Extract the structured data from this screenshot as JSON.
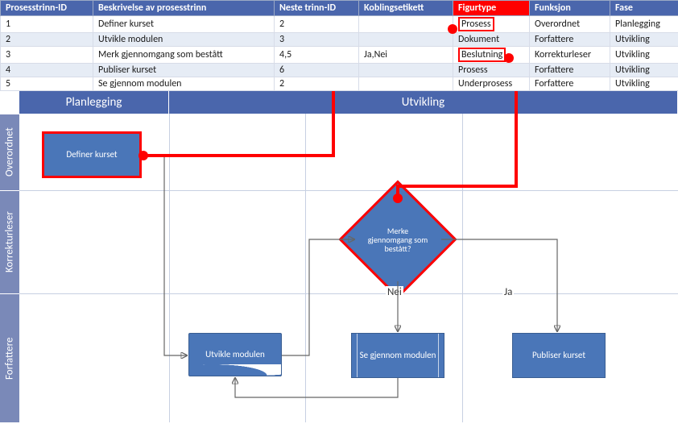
{
  "table": {
    "headers": {
      "id": "Prosesstrinn-ID",
      "desc": "Beskrivelse av prosesstrinn",
      "next": "Neste trinn-ID",
      "conn": "Koblingsetikett",
      "shape": "Figurtype",
      "func": "Funksjon",
      "phase": "Fase"
    },
    "rows": [
      {
        "id": "1",
        "desc": "Definer kurset",
        "next": "2",
        "conn": "",
        "shape": "Prosess",
        "func": "Overordnet",
        "phase": "Planlegging"
      },
      {
        "id": "2",
        "desc": "Utvikle modulen",
        "next": "3",
        "conn": "",
        "shape": "Dokument",
        "func": "Forfattere",
        "phase": "Utvikling"
      },
      {
        "id": "3",
        "desc": "Merk gjennomgang som bestått",
        "next": "4,5",
        "conn": "Ja,Nei",
        "shape": "Beslutning",
        "func": "Korrekturleser",
        "phase": "Utvikling"
      },
      {
        "id": "4",
        "desc": "Publiser kurset",
        "next": "6",
        "conn": "",
        "shape": "Prosess",
        "func": "Forfattere",
        "phase": "Utvikling"
      },
      {
        "id": "5",
        "desc": "Se gjennom modulen",
        "next": "2",
        "conn": "",
        "shape": "Underprosess",
        "func": "Forfattere",
        "phase": "Utvikling"
      }
    ]
  },
  "phases": {
    "planning": "Planlegging",
    "development": "Utvikling"
  },
  "lanes": {
    "overordnet": "Overordnet",
    "korrekturleser": "Korrekturleser",
    "forfattere": "Forfattere"
  },
  "shapes": {
    "define": "Definer kurset",
    "decision": "Merke gjennomgang som bestått?",
    "develop": "Utvikle modulen",
    "review": "Se gjennom modulen",
    "publish": "Publiser kurset"
  },
  "labels": {
    "yes": "Ja",
    "no": "Nei"
  }
}
